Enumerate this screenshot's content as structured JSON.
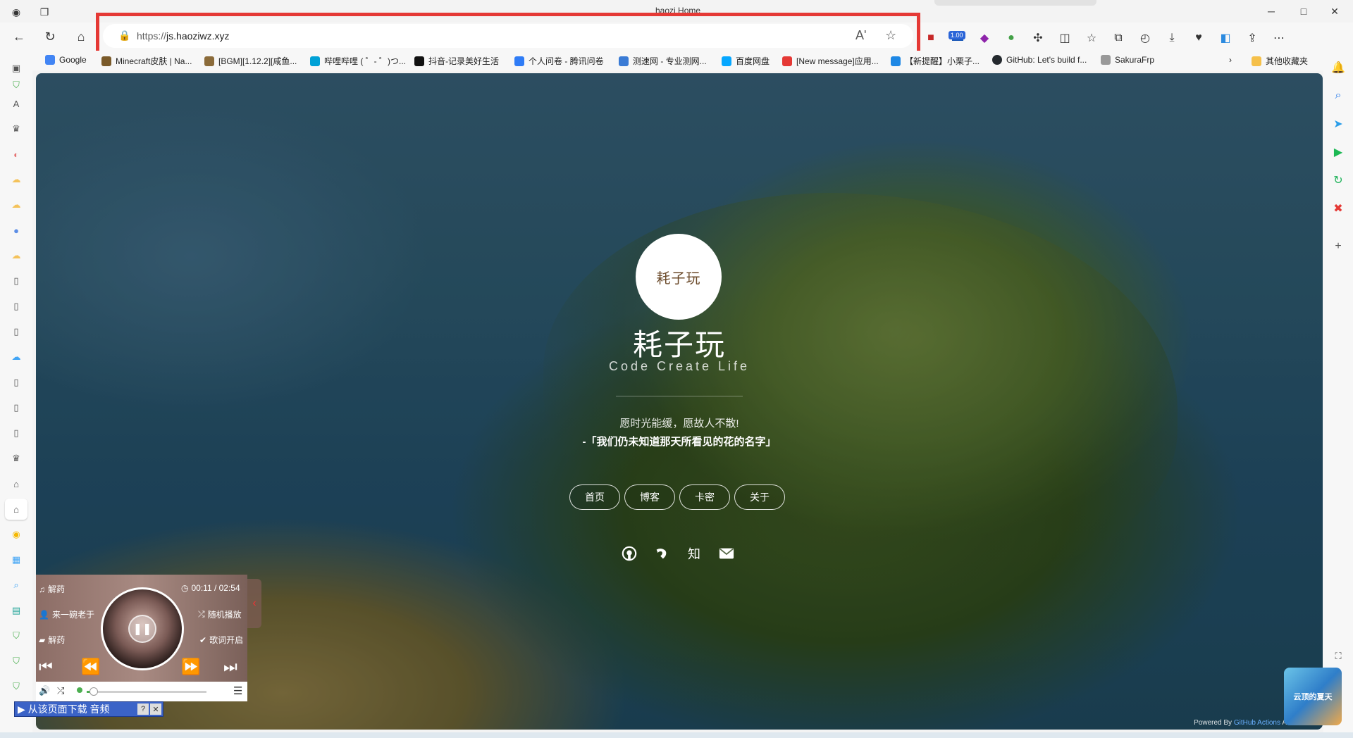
{
  "window": {
    "tab_title": "haozi Home",
    "min": "─",
    "max": "□",
    "close": "✕"
  },
  "toolbar": {
    "url_scheme": "https://",
    "url_host": "js.haoziwz.xyz",
    "read_aloud": "Aʹ",
    "favorite": "☆",
    "ext_badge": "1.00"
  },
  "bookmarks": [
    {
      "label": "Google",
      "color": "#4285f4"
    },
    {
      "label": "Minecraft皮肤 | Na...",
      "color": "#7a5a2a"
    },
    {
      "label": "[BGM][1.12.2][咸鱼...",
      "color": "#8b6b3a"
    },
    {
      "label": "哔哩哔哩 ( ゜- ゜)つ...",
      "color": "#00a1d6"
    },
    {
      "label": "抖音-记录美好生活",
      "color": "#111111"
    },
    {
      "label": "个人问卷 - 腾讯问卷",
      "color": "#2f7cf6"
    },
    {
      "label": "测速网 - 专业测网...",
      "color": "#3a7bd5"
    },
    {
      "label": "百度网盘",
      "color": "#06a7ff"
    },
    {
      "label": "[New message]应用...",
      "color": "#e53935"
    },
    {
      "label": "【新提醒】小栗子...",
      "color": "#1e88e5"
    },
    {
      "label": "GitHub: Let's build f...",
      "color": "#24292e"
    },
    {
      "label": "SakuraFrp",
      "color": "#999999"
    }
  ],
  "bookmarks_more": "›",
  "bookmarks_other": "其他收藏夹",
  "site": {
    "avatar_text": "耗子玩",
    "title": "耗子玩",
    "subtitle": "Code Create Life",
    "quote_line1": "愿时光能缓，愿故人不散!",
    "quote_line2": "-「我们仍未知道那天所看见的花的名字」",
    "nav": [
      "首页",
      "博客",
      "卡密",
      "关于"
    ],
    "social_icons": [
      "github-icon",
      "yuque-icon",
      "zhihu-icon",
      "mail-icon"
    ],
    "zhihu_text": "知",
    "powered_prefix": "Powered By ",
    "powered_link": "GitHub Actions",
    "powered_suffix": " And H"
  },
  "player": {
    "song": "解药",
    "artist": "来一碗老于",
    "album": "解药",
    "time": "00:11 / 02:54",
    "mode": "随机播放",
    "lyrics": "歌词开启",
    "progress": 0.06
  },
  "download_bar": {
    "label": "▶ 从该页面下载 音频",
    "help": "?",
    "close": "✕"
  },
  "thumbnail_text": "云顶的夏天"
}
